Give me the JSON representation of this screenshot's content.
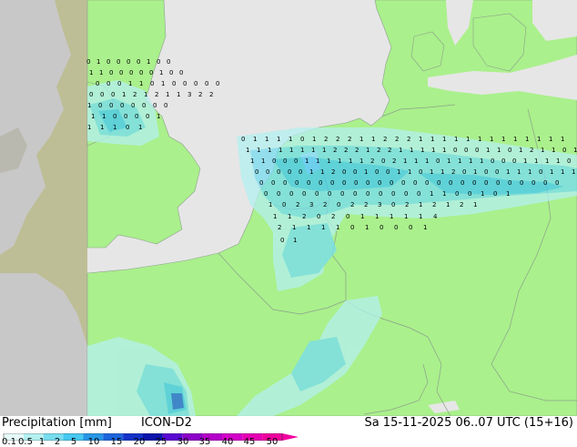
{
  "header": {
    "title": "Precipitation [mm]",
    "model": "ICON-D2",
    "datetime": "Sa 15-11-2025 06..07 UTC (15+16)"
  },
  "legend": {
    "ticks": [
      "0.1",
      "0.5",
      "1",
      "2",
      "5",
      "10",
      "15",
      "20",
      "25",
      "30",
      "35",
      "40",
      "45",
      "50"
    ],
    "colors": [
      "#e6fafa",
      "#b4f0f0",
      "#78dcf0",
      "#46c8f0",
      "#2896e6",
      "#1e64dc",
      "#1432c8",
      "#0a14aa",
      "#5a0ad2",
      "#8c00c8",
      "#b400c8",
      "#d200c8",
      "#e600b4",
      "#f000a0"
    ]
  },
  "map": {
    "colors": {
      "sea": "#e6e6e6",
      "land_domain": "#aaf08c",
      "land_outside": "#c8c8c8",
      "outside_overlay": "#bebe96",
      "border": "#8ca08c"
    },
    "labels": [
      "0",
      "1",
      "0",
      "0",
      "0",
      "0",
      "1",
      "0",
      "0",
      "1",
      "1",
      "0",
      "0",
      "0",
      "0",
      "0",
      "1",
      "0",
      "0",
      "0",
      "0",
      "0",
      "1",
      "1",
      "0",
      "1",
      "0",
      "0",
      "0",
      "0",
      "0",
      "0",
      "0",
      "0",
      "1",
      "2",
      "1",
      "2",
      "1",
      "1",
      "3",
      "2",
      "2",
      "1",
      "0",
      "0",
      "0",
      "0",
      "0",
      "0",
      "0",
      "1",
      "1",
      "0",
      "0",
      "0",
      "0",
      "1",
      "1",
      "1",
      "1",
      "0",
      "1",
      "0",
      "1",
      "1",
      "1",
      "1",
      "0",
      "1",
      "2",
      "2",
      "2",
      "1",
      "1",
      "2",
      "2",
      "2",
      "1",
      "1",
      "1",
      "1",
      "1",
      "1",
      "1",
      "1",
      "1",
      "1",
      "1",
      "1",
      "1",
      "1",
      "1",
      "1",
      "1",
      "1",
      "1",
      "1",
      "1",
      "2",
      "2",
      "2",
      "1",
      "2",
      "2",
      "1",
      "1",
      "1",
      "1",
      "1",
      "0",
      "0",
      "0",
      "1",
      "1",
      "0",
      "1",
      "2",
      "1",
      "1",
      "0",
      "1",
      "1",
      "1",
      "0",
      "0",
      "0",
      "1",
      "1",
      "1",
      "1",
      "1",
      "1",
      "2",
      "0",
      "2",
      "1",
      "1",
      "1",
      "0",
      "1",
      "1",
      "1",
      "1",
      "0",
      "0",
      "0",
      "1",
      "1",
      "1",
      "1",
      "0",
      "0",
      "0",
      "0",
      "0",
      "0",
      "1",
      "1",
      "2",
      "0",
      "0",
      "1",
      "0",
      "0",
      "1",
      "1",
      "0",
      "1",
      "1",
      "2",
      "0",
      "1",
      "0",
      "0",
      "1",
      "1",
      "1",
      "0",
      "1",
      "1",
      "1",
      "0",
      "0",
      "0",
      "0",
      "0",
      "0",
      "0",
      "0",
      "0",
      "0",
      "0",
      "0",
      "0",
      "0",
      "0",
      "0",
      "0",
      "0",
      "0",
      "0",
      "0",
      "0",
      "0",
      "0",
      "0",
      "0",
      "0",
      "0",
      "0",
      "0",
      "0",
      "0",
      "0",
      "0",
      "0",
      "0",
      "0",
      "0",
      "0",
      "1",
      "1",
      "0",
      "0",
      "1",
      "0",
      "1",
      "1",
      "0",
      "2",
      "3",
      "2",
      "0",
      "2",
      "2",
      "3",
      "0",
      "2",
      "1",
      "2",
      "1",
      "2",
      "1",
      "1",
      "1",
      "2",
      "0",
      "2",
      "0",
      "1",
      "1",
      "1",
      "1",
      "1",
      "4",
      "2",
      "1",
      "1",
      "1",
      "1",
      "0",
      "1",
      "0",
      "0",
      "0",
      "1",
      "0",
      "1"
    ]
  }
}
